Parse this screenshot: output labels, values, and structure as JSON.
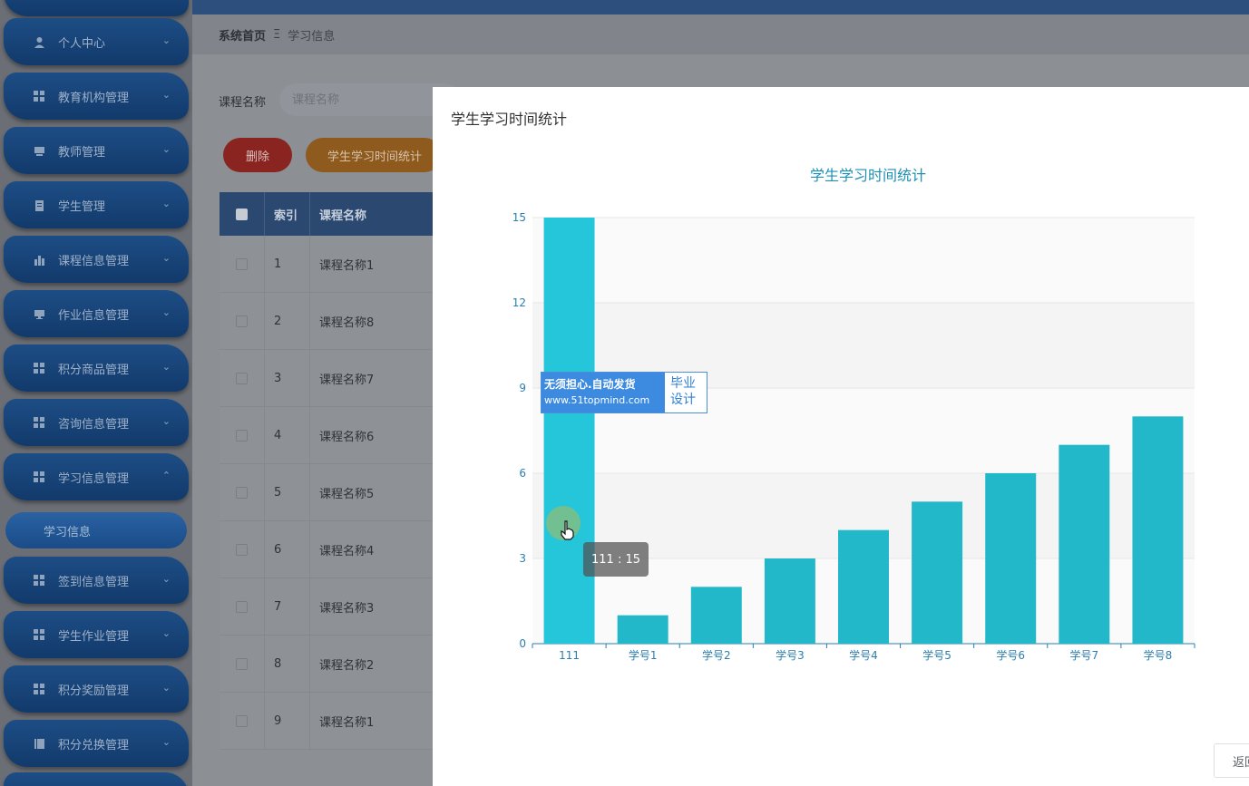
{
  "sidebar": {
    "items": [
      {
        "label": "个人中心",
        "icon": "user-icon",
        "chevron": "⌄"
      },
      {
        "label": "教育机构管理",
        "icon": "grid-icon",
        "chevron": "⌄"
      },
      {
        "label": "教师管理",
        "icon": "monitor-icon",
        "chevron": "⌄"
      },
      {
        "label": "学生管理",
        "icon": "clipboard-icon",
        "chevron": "⌄"
      },
      {
        "label": "课程信息管理",
        "icon": "bar-chart-icon",
        "chevron": "⌄"
      },
      {
        "label": "作业信息管理",
        "icon": "monitor-icon",
        "chevron": "⌄"
      },
      {
        "label": "积分商品管理",
        "icon": "grid-icon",
        "chevron": "⌄"
      },
      {
        "label": "咨询信息管理",
        "icon": "grid-icon",
        "chevron": "⌄"
      },
      {
        "label": "学习信息管理",
        "icon": "grid-icon",
        "chevron": "⌃"
      },
      {
        "label": "签到信息管理",
        "icon": "grid-icon",
        "chevron": "⌄"
      },
      {
        "label": "学生作业管理",
        "icon": "grid-icon",
        "chevron": "⌄"
      },
      {
        "label": "积分奖励管理",
        "icon": "grid-icon",
        "chevron": "⌄"
      },
      {
        "label": "积分兑换管理",
        "icon": "book-icon",
        "chevron": "⌄"
      }
    ],
    "sub_item": "学习信息"
  },
  "breadcrumb": {
    "home": "系统首页",
    "separator": "Ξ",
    "current": "学习信息"
  },
  "search": {
    "label": "课程名称",
    "placeholder": "课程名称"
  },
  "buttons": {
    "delete": "删除",
    "stats": "学生学习时间统计"
  },
  "table": {
    "headers": [
      "索引",
      "课程名称"
    ],
    "rows": [
      {
        "index": "1",
        "name": "课程名称1"
      },
      {
        "index": "2",
        "name": "课程名称8"
      },
      {
        "index": "3",
        "name": "课程名称7"
      },
      {
        "index": "4",
        "name": "课程名称6"
      },
      {
        "index": "5",
        "name": "课程名称5"
      },
      {
        "index": "6",
        "name": "课程名称4"
      },
      {
        "index": "7",
        "name": "课程名称3"
      },
      {
        "index": "8",
        "name": "课程名称2"
      },
      {
        "index": "9",
        "name": "课程名称1"
      }
    ]
  },
  "dialog": {
    "title": "学生学习时间统计",
    "back_button": "返回"
  },
  "watermark": {
    "line1": "无须担心.自动发货",
    "line2": "www.51topmind.com",
    "right": "毕业设计"
  },
  "tooltip": "111 : 15",
  "colors": {
    "bar": "#22b7c9",
    "bar_highlight": "#26c6da",
    "title": "#1e8fb4",
    "sidebar": "#1d4d85"
  },
  "chart_data": {
    "type": "bar",
    "title": "学生学习时间统计",
    "categories": [
      "111",
      "学号1",
      "学号2",
      "学号3",
      "学号4",
      "学号5",
      "学号6",
      "学号7",
      "学号8"
    ],
    "values": [
      15,
      1,
      2,
      3,
      4,
      5,
      6,
      7,
      8
    ],
    "yticks": [
      0,
      3,
      6,
      9,
      12,
      15
    ],
    "ylim": [
      0,
      15
    ],
    "xlabel": "",
    "ylabel": "",
    "grid": true,
    "highlighted_category": "111"
  }
}
